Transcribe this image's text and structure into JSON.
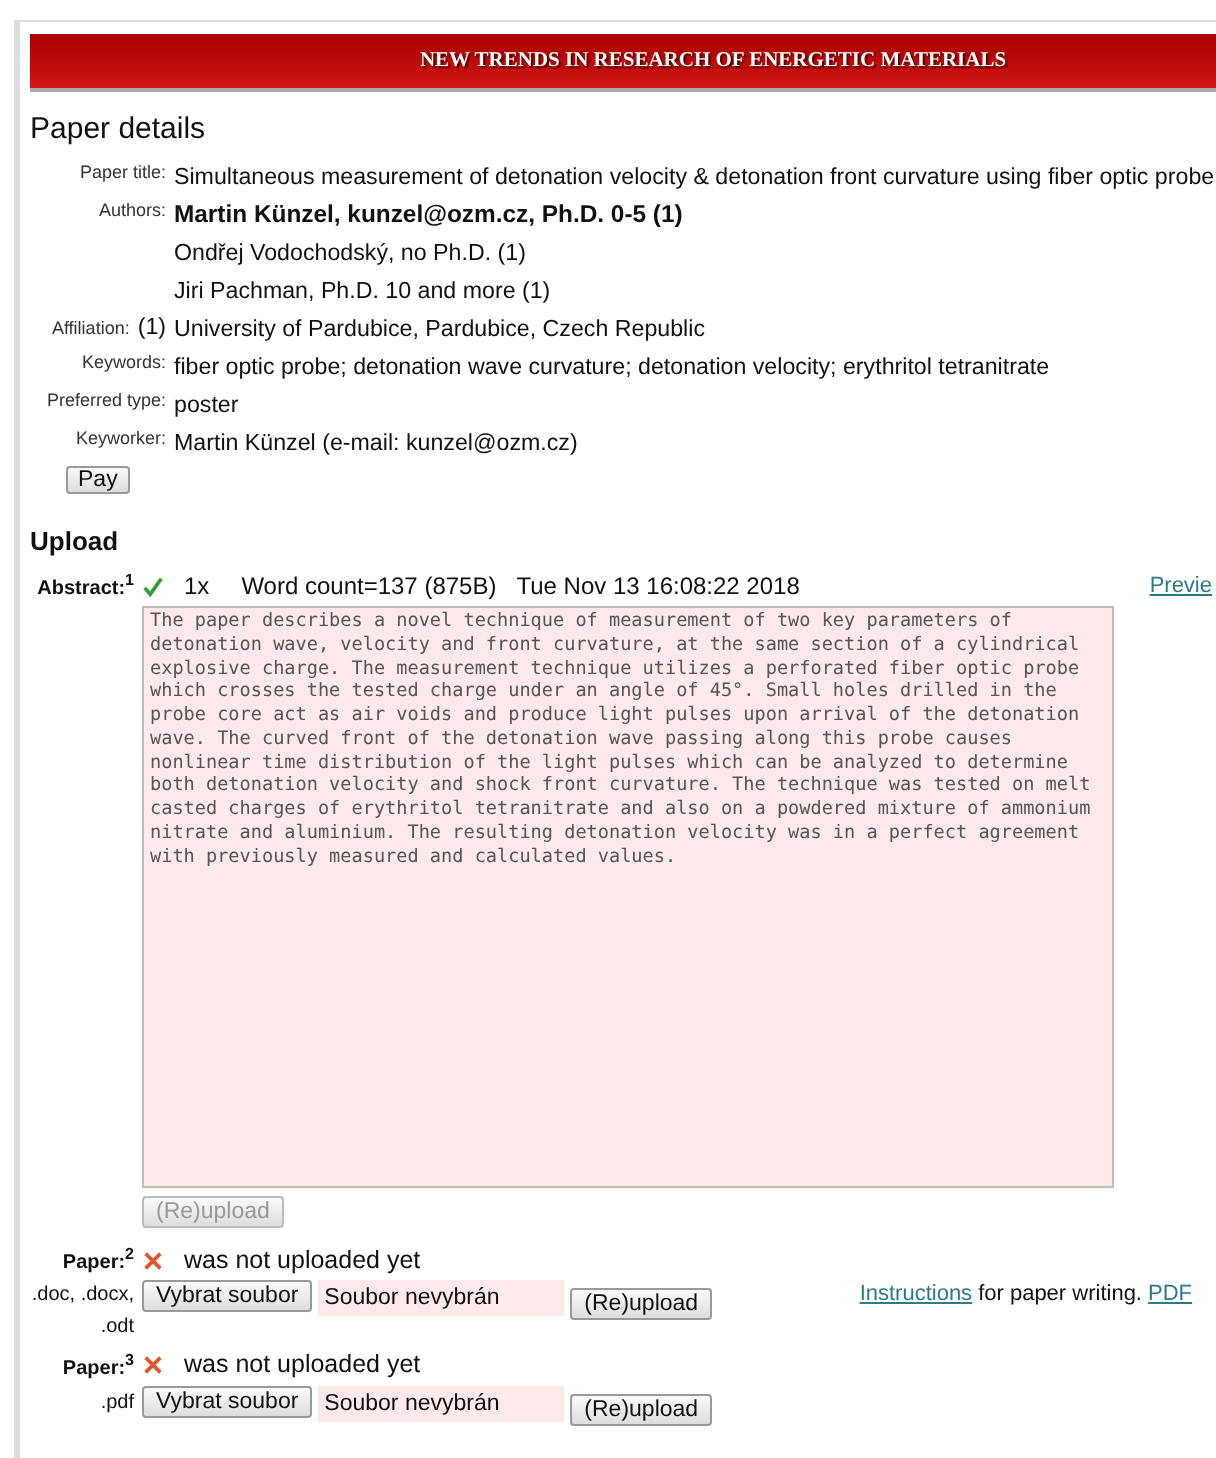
{
  "banner": {
    "title": "NEW TRENDS IN RESEARCH OF ENERGETIC MATERIALS"
  },
  "details": {
    "heading": "Paper details",
    "rows": [
      {
        "label": "Paper title:",
        "values": [
          {
            "text": "Simultaneous measurement of detonation velocity & detonation front curvature using fiber optic probe",
            "highlighted": false
          }
        ]
      },
      {
        "label": "Authors:",
        "values": [
          {
            "text": "Martin Künzel, kunzel@ozm.cz, Ph.D. 0-5 (1)",
            "highlighted": true
          },
          {
            "text": "Ondřej Vodochodský, no Ph.D. (1)",
            "highlighted": false
          },
          {
            "text": "Jiri Pachman, Ph.D. 10 and more (1)",
            "highlighted": false
          }
        ]
      },
      {
        "label": "Affiliation:",
        "index": "(1)",
        "values": [
          {
            "text": "University of Pardubice, Pardubice, Czech Republic",
            "highlighted": false
          }
        ]
      },
      {
        "label": "Keywords:",
        "values": [
          {
            "text": "fiber optic probe; detonation wave curvature; detonation velocity; erythritol tetranitrate",
            "highlighted": false
          }
        ]
      },
      {
        "label": "Preferred type:",
        "values": [
          {
            "text": "poster",
            "highlighted": false
          }
        ]
      },
      {
        "label": "Keyworker:",
        "values": [
          {
            "text": "Martin Künzel (e-mail: kunzel@ozm.cz)",
            "highlighted": false
          }
        ]
      }
    ],
    "pay_button": "Pay"
  },
  "upload": {
    "heading": "Upload",
    "abstract": {
      "label": "Abstract:",
      "note": "1",
      "uploaded": true,
      "count": "1x",
      "word_count": "Word count=137 (875B)",
      "date": "Tue Nov 13 16:08:22 2018",
      "preview_link": "Previe",
      "text": "The paper describes a novel technique of measurement of two key parameters of detonation wave, velocity and front curvature, at the same section of a cylindrical explosive charge. The measurement technique utilizes a perforated fiber optic probe which crosses the tested charge under an angle of 45°. Small holes drilled in the probe core act as air voids and produce light pulses upon arrival of the detonation wave. The curved front of the detonation wave passing along this probe causes nonlinear time distribution of the light pulses which can be analyzed to determine both detonation velocity and shock front curvature. The technique was tested on melt casted charges of erythritol tetranitrate and also on a powdered mixture of ammonium nitrate and aluminium. The resulting detonation velocity was in a perfect agreement with previously measured and calculated values.",
      "upload_button": {
        "label": "(Re)upload",
        "disabled": true
      }
    },
    "papers": [
      {
        "label": "Paper:",
        "note": "2",
        "uploaded": false,
        "status": "was not uploaded yet",
        "formats": ".doc, .docx, .odt",
        "choose_button": "Vybrat soubor",
        "file_name": "Soubor nevybrán",
        "upload_button": {
          "label": "(Re)upload",
          "disabled": false
        },
        "help": {
          "link": "Instructions",
          "text": "for paper writing.",
          "pdf_link": "PDF"
        }
      },
      {
        "label": "Paper:",
        "note": "3",
        "uploaded": false,
        "status": "was not uploaded yet",
        "formats": ".pdf",
        "choose_button": "Vybrat soubor",
        "file_name": "Soubor nevybrán",
        "upload_button": {
          "label": "(Re)upload",
          "disabled": false
        }
      }
    ]
  }
}
